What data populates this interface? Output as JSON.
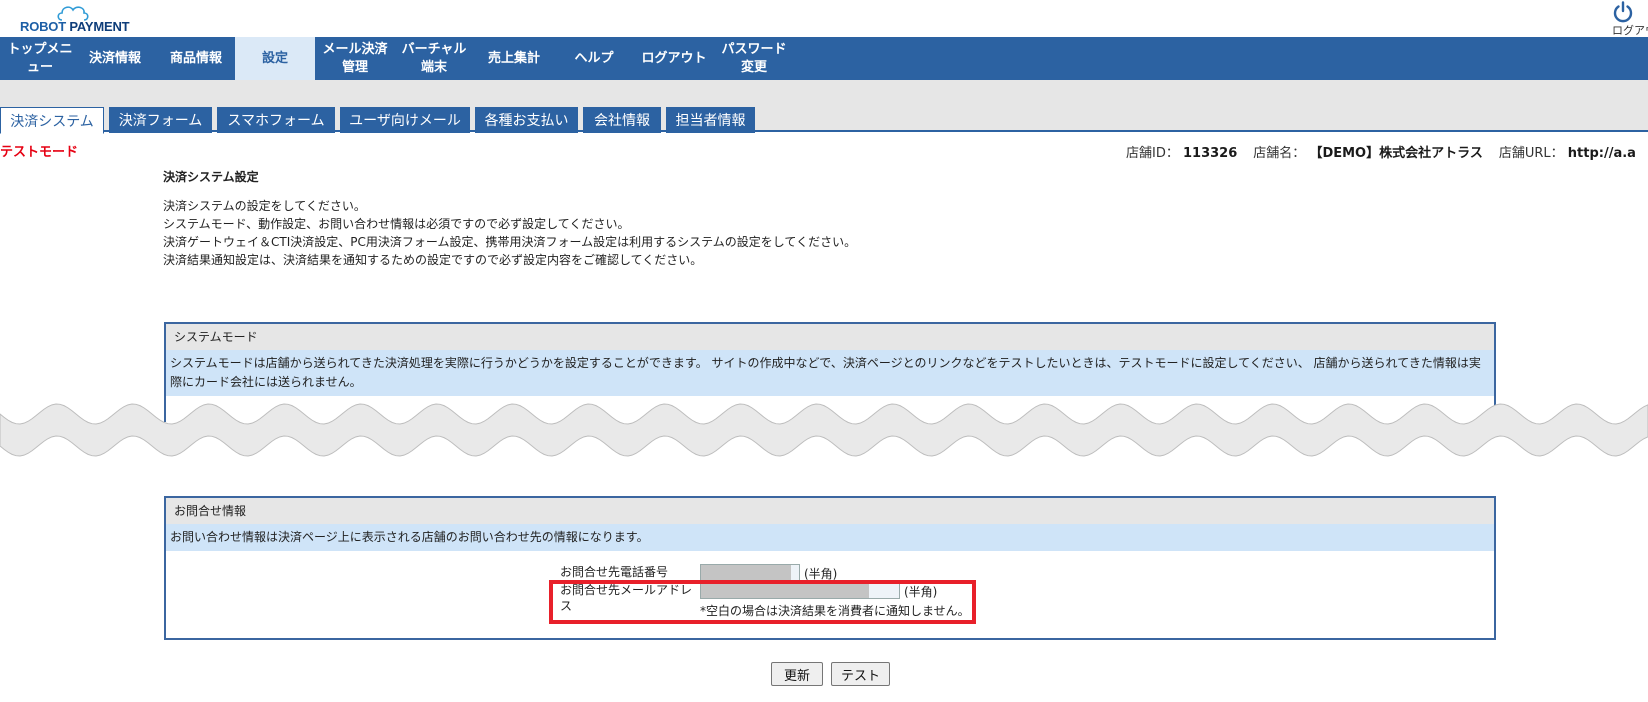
{
  "brand": {
    "logo_word1": "ROBOT",
    "logo_word2": "PAYMENT",
    "accent": "#2c62a2"
  },
  "top_right": {
    "logout_label": "ログアウ"
  },
  "main_nav": [
    {
      "label": "トップメニュー",
      "active": false
    },
    {
      "label": "決済情報",
      "active": false
    },
    {
      "label": "商品情報",
      "active": false
    },
    {
      "label": "設定",
      "active": true
    },
    {
      "label": "メール決済管理",
      "active": false
    },
    {
      "label": "バーチャル端末",
      "active": false
    },
    {
      "label": "売上集計",
      "active": false
    },
    {
      "label": "ヘルプ",
      "active": false
    },
    {
      "label": "ログアウト",
      "active": false
    },
    {
      "label": "パスワード変更",
      "active": false
    }
  ],
  "sub_tabs": [
    {
      "label": "決済システム",
      "active": true
    },
    {
      "label": "決済フォーム",
      "active": false
    },
    {
      "label": "スマホフォーム",
      "active": false
    },
    {
      "label": "ユーザ向けメール",
      "active": false
    },
    {
      "label": "各種お支払い",
      "active": false
    },
    {
      "label": "会社情報",
      "active": false
    },
    {
      "label": "担当者情報",
      "active": false
    }
  ],
  "mode_label": "テストモード",
  "shop": {
    "id_label": "店舗ID：",
    "id_value": "113326",
    "name_label": "店舗名：",
    "name_value": "【DEMO】株式会社アトラス",
    "url_label": "店舗URL：",
    "url_value": "http://a.a"
  },
  "page": {
    "title": "決済システム設定",
    "description": [
      "決済システムの設定をしてください。",
      "システムモード、動作設定、お問い合わせ情報は必須ですので必ず設定してください。",
      "決済ゲートウェイ＆CTI決済設定、PC用決済フォーム設定、携帯用決済フォーム設定は利用するシステムの設定をしてください。",
      "決済結果通知設定は、決済結果を通知するための設定ですので必ず設定内容をご確認してください。"
    ]
  },
  "system_mode": {
    "title": "システムモード",
    "description": "システムモードは店舗から送られてきた決済処理を実際に行うかどうかを設定することができます。 サイトの作成中などで、決済ページとのリンクなどをテストしたいときは、テストモードに設定してください、 店舗から送られてきた情報は実際にカード会社には送られません。"
  },
  "contact": {
    "title": "お問合せ情報",
    "description": "お問い合わせ情報は決済ページ上に表示される店舗のお問い合わせ先の情報になります。",
    "phone_label": "お問合せ先電話番号",
    "phone_suffix": "(半角)",
    "email_label_line1": "お問合せ先メールアドレ",
    "email_label_line2": "ス",
    "email_suffix": "(半角)",
    "email_note": "*空白の場合は決済結果を消費者に通知しません。"
  },
  "buttons": {
    "update": "更新",
    "test": "テスト"
  },
  "colors": {
    "highlight": "#e8202a",
    "test_mode": "#e60012",
    "panel_desc_bg": "#cfe4f8"
  }
}
